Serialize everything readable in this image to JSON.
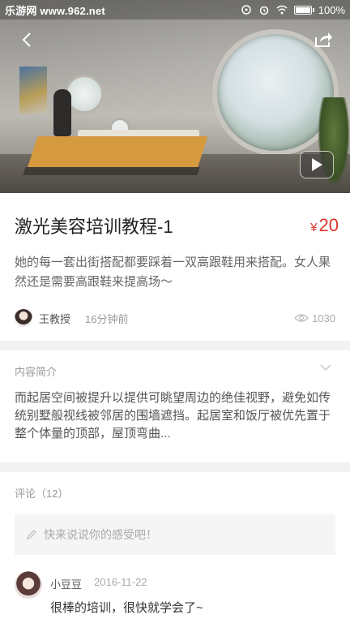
{
  "status_bar": {
    "site": "乐游网 www.962.net",
    "battery": "100%",
    "battery_level": 1.0
  },
  "hero": {
    "back_icon": "back-arrow-icon",
    "share_icon": "share-icon",
    "play_icon": "play-icon"
  },
  "article": {
    "title": "激光美容培训教程-1",
    "price_currency": "¥",
    "price_value": "20",
    "description": "她的每一套出街搭配都要踩着一双高跟鞋用来搭配。女人果然还是需要高跟鞋来提高场～",
    "author": "王教授",
    "time": "16分钟前",
    "views": "1030"
  },
  "intro": {
    "label": "内容简介",
    "text": "而起居空间被提升以提供可眺望周边的绝佳视野，避免如传统别墅般视线被邻居的围墙遮挡。起居室和饭厅被优先置于整个体量的顶部，屋顶弯曲..."
  },
  "comments": {
    "label": "评论（12）",
    "placeholder": "快来说说你的感受吧！",
    "items": [
      {
        "user": "小豆豆",
        "date": "2016-11-22",
        "text": "很棒的培训，很快就学会了~"
      }
    ]
  },
  "colors": {
    "accent": "#e0352b",
    "separator": "#f2f2f2"
  }
}
